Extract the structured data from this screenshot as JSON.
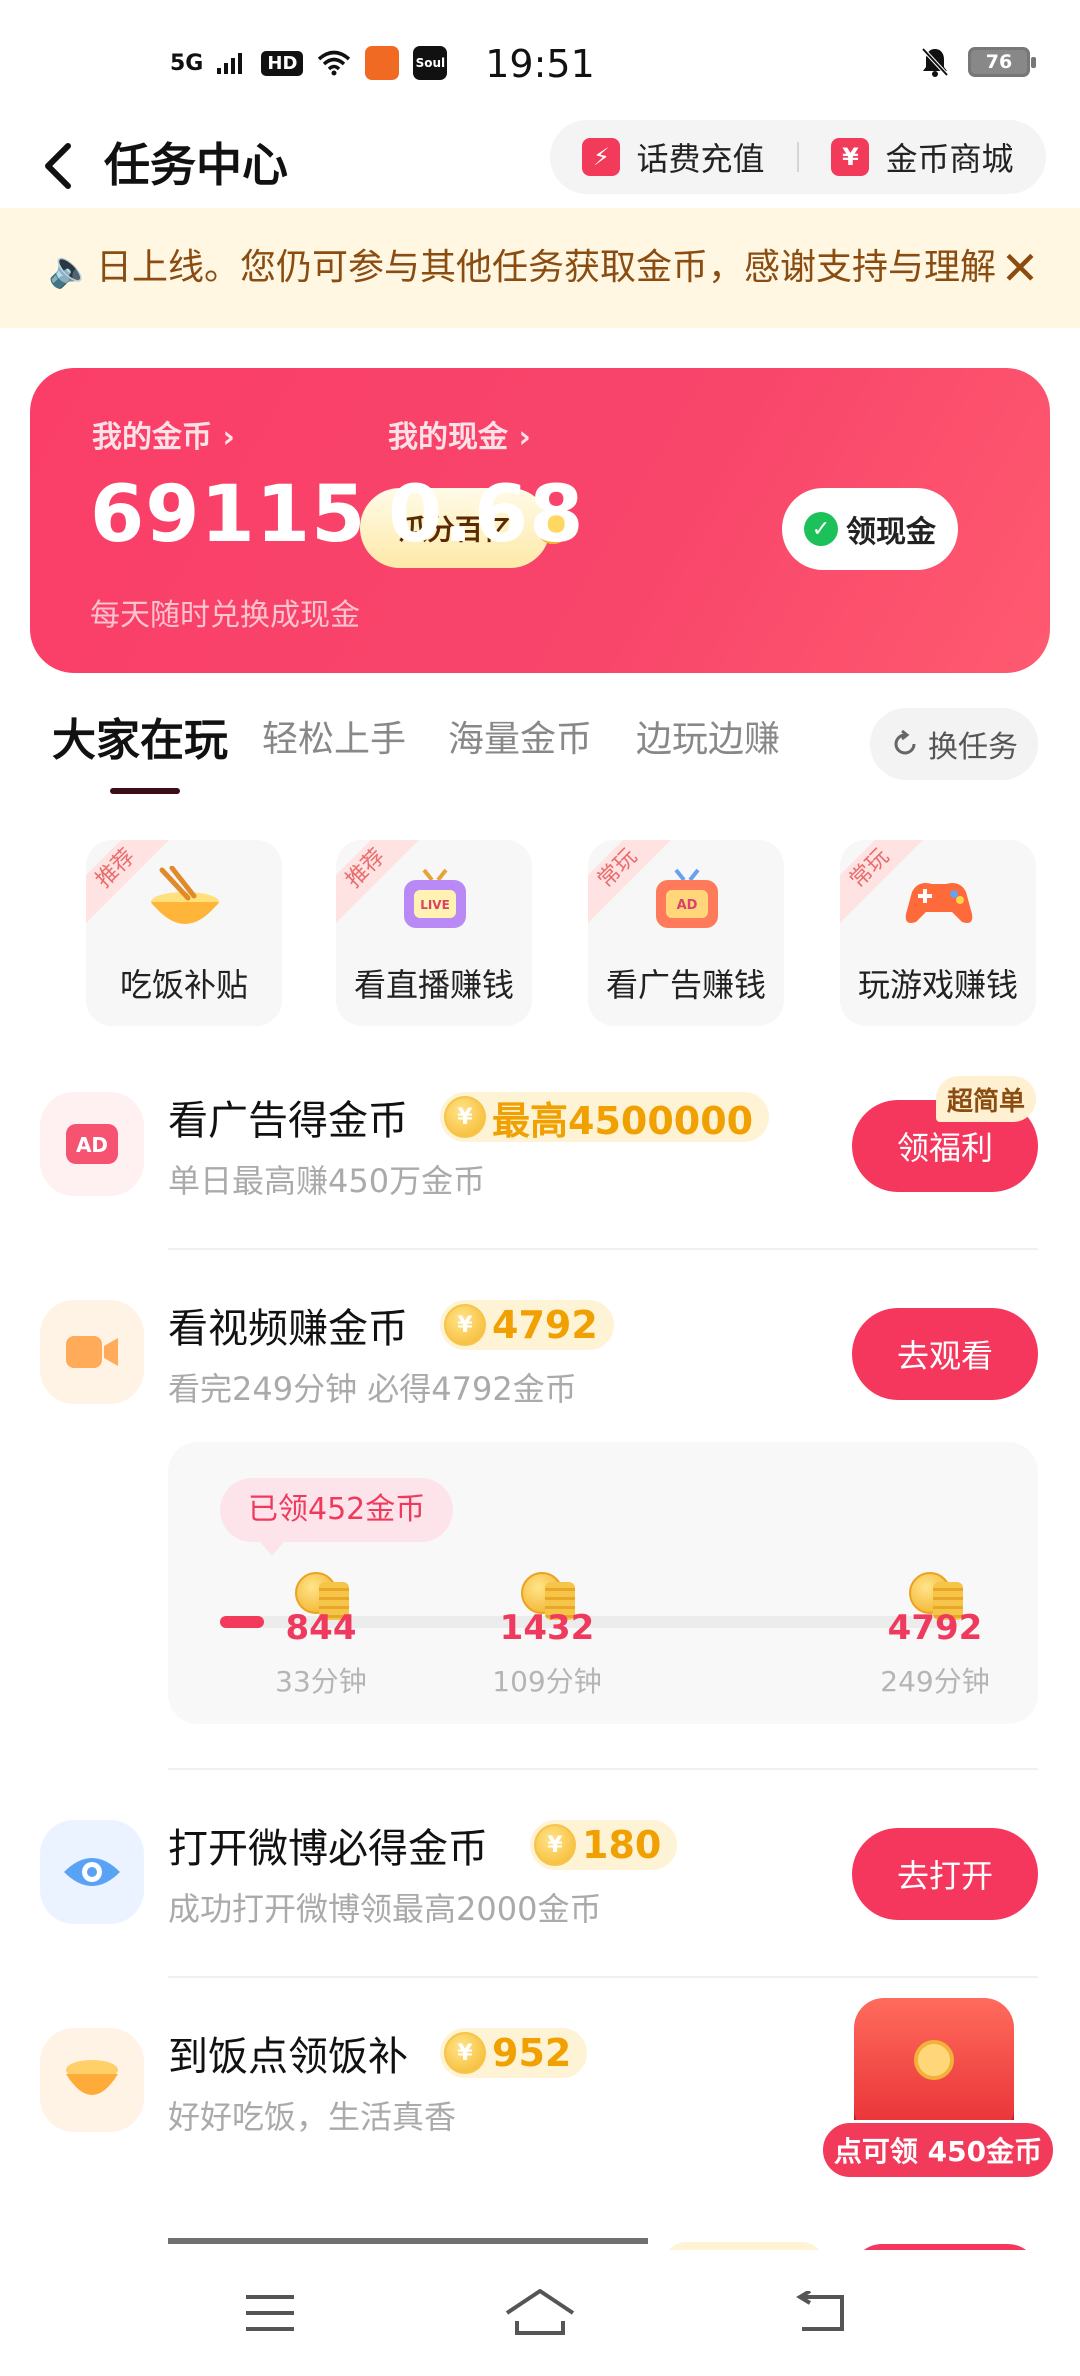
{
  "status_bar": {
    "network": "5G",
    "hd": "HD",
    "app_icon_1": "Soul",
    "time": "19:51",
    "battery": "76"
  },
  "header": {
    "title": "任务中心",
    "recharge_label": "话费充值",
    "mall_label": "金币商城"
  },
  "notice": {
    "text": "日上线。您仍可参与其他任务获取金币，感谢支持与理解"
  },
  "wallet": {
    "coins_label": "我的金币",
    "coins_value": "69115",
    "coins_sub": "每天随时兑换成现金",
    "share_label": "瓜分百亿",
    "cash_label": "我的现金",
    "cash_value": "0.68",
    "withdraw_label": "领现金"
  },
  "tabs": {
    "items": [
      "大家在玩",
      "轻松上手",
      "海量金币",
      "边玩边赚"
    ],
    "active": "大家在玩",
    "swap_label": "换任务"
  },
  "quick": [
    {
      "badge": "推荐",
      "label": "吃饭补贴",
      "icon": "rice-bowl-icon"
    },
    {
      "badge": "推荐",
      "label": "看直播赚钱",
      "icon": "live-tv-icon"
    },
    {
      "badge": "常玩",
      "label": "看广告赚钱",
      "icon": "ad-tv-icon"
    },
    {
      "badge": "常玩",
      "label": "玩游戏赚钱",
      "icon": "gamepad-icon"
    }
  ],
  "tasks": {
    "ad": {
      "title": "看广告得金币",
      "coin": "最高4500000",
      "sub": "单日最高赚450万金币",
      "button": "领福利",
      "tag": "超简单"
    },
    "video": {
      "title": "看视频赚金币",
      "coin": "4792",
      "sub": "看完249分钟 必得4792金币",
      "button": "去观看",
      "received": "已领452金币",
      "progress": 0.06,
      "milestones": [
        {
          "coins": "844",
          "time": "33分钟"
        },
        {
          "coins": "1432",
          "time": "109分钟"
        },
        {
          "coins": "4792",
          "time": "249分钟"
        }
      ]
    },
    "weibo": {
      "title": "打开微博必得金币",
      "coin": "180",
      "sub": "成功打开微博领最高2000金币",
      "button": "去打开"
    },
    "meal": {
      "title": "到饭点领饭补",
      "coin": "952",
      "sub": "好好吃饭，生活真香",
      "float_label": "点可领 450金币"
    }
  },
  "colors": {
    "accent": "#f5375e",
    "coin_gold": "#f0a000",
    "notice_bg": "#fff7e2"
  }
}
